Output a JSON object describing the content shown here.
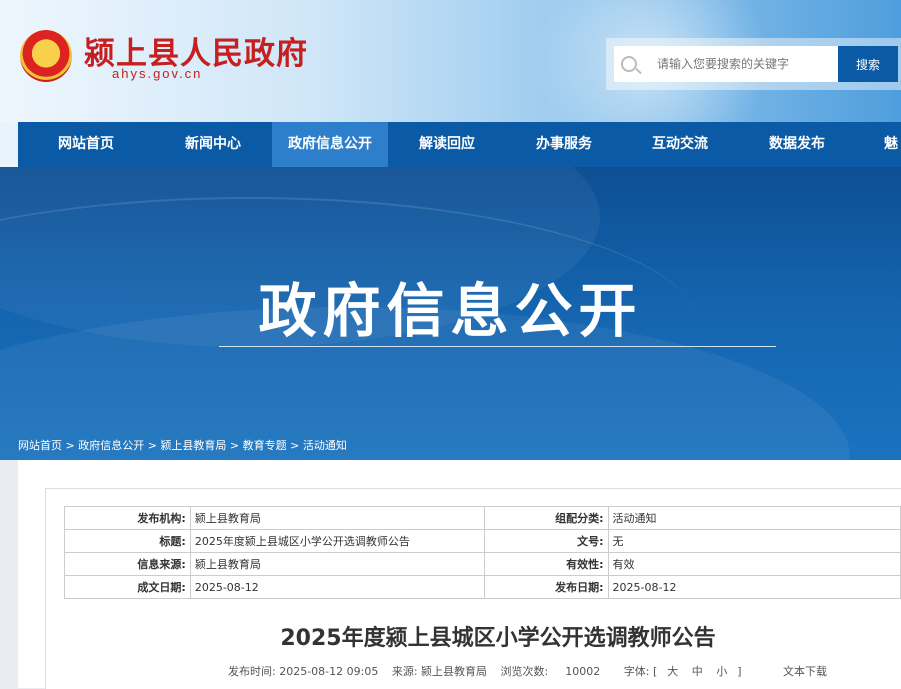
{
  "header": {
    "site_title": "颍上县人民政府",
    "site_url": "ahys.gov.cn",
    "search_placeholder": "请输入您要搜索的关键字",
    "search_button": "搜索"
  },
  "nav": {
    "items": [
      {
        "label": "网站首页"
      },
      {
        "label": "新闻中心"
      },
      {
        "label": "政府信息公开"
      },
      {
        "label": "解读回应"
      },
      {
        "label": "办事服务"
      },
      {
        "label": "互动交流"
      },
      {
        "label": "数据发布"
      },
      {
        "label": "魅"
      }
    ],
    "active": "政府信息公开"
  },
  "banner": {
    "title": "政府信息公开"
  },
  "breadcrumb": {
    "items": [
      "网站首页",
      "政府信息公开",
      "颍上县教育局",
      "教育专题",
      "活动通知"
    ],
    "separator": " > "
  },
  "meta_table": {
    "rows": [
      {
        "l1": "发布机构:",
        "v1": "颍上县教育局",
        "l2": "组配分类:",
        "v2": "活动通知"
      },
      {
        "l1": "标题:",
        "v1": "2025年度颍上县城区小学公开选调教师公告",
        "l2": "文号:",
        "v2": "无"
      },
      {
        "l1": "信息来源:",
        "v1": "颍上县教育局",
        "l2": "有效性:",
        "v2": "有效"
      },
      {
        "l1": "成文日期:",
        "v1": "2025-08-12",
        "l2": "发布日期:",
        "v2": "2025-08-12"
      }
    ]
  },
  "article": {
    "title": "2025年度颍上县城区小学公开选调教师公告",
    "publish_time": "发布时间: 2025-08-12 09:05",
    "source": "来源: 颍上县教育局",
    "views_label": "浏览次数:",
    "views": "10002",
    "font_label": "字体: [",
    "font_large": "大",
    "font_medium": "中",
    "font_small": "小",
    "font_close": "]",
    "text_download": "文本下载"
  }
}
